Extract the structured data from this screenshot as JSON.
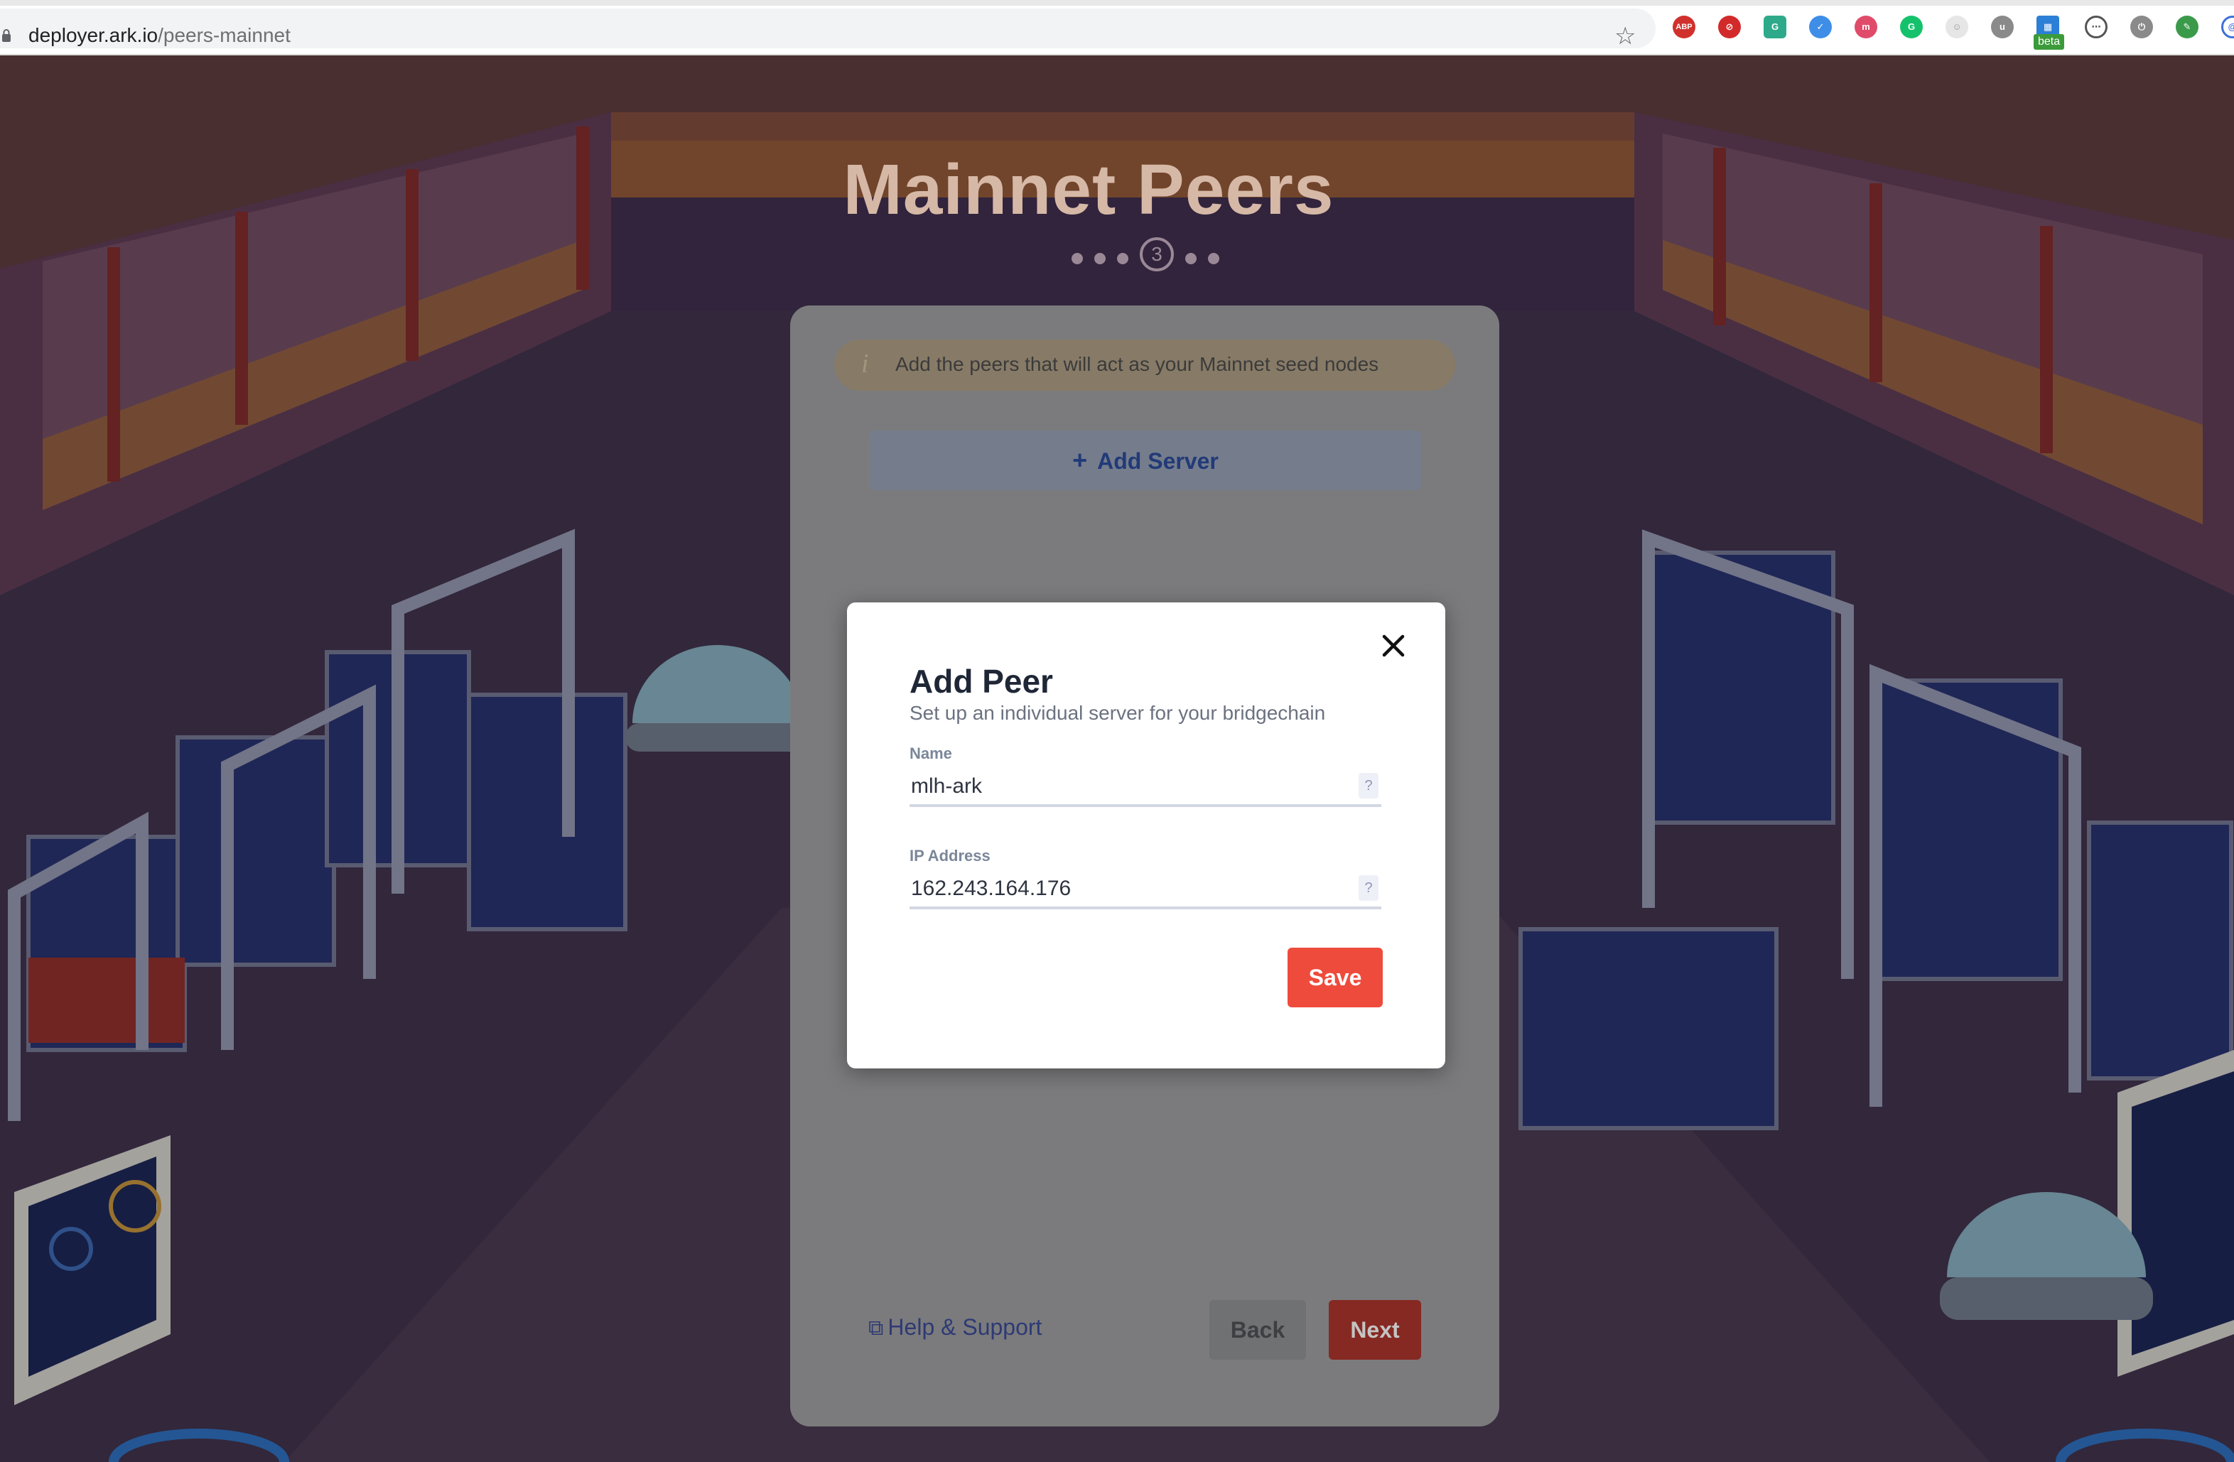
{
  "browser": {
    "url_host": "deployer.ark.io",
    "url_path": "/peers-mainnet",
    "extension_badge": "beta"
  },
  "page": {
    "title": "Mainnet Peers",
    "current_step": "3",
    "info_text": "Add the peers that will act as your Mainnet seed nodes",
    "add_server_label": "Add Server",
    "help_link": "Help & Support",
    "back_label": "Back",
    "next_label": "Next"
  },
  "modal": {
    "title": "Add Peer",
    "subtitle": "Set up an individual server for your bridgechain",
    "name_label": "Name",
    "name_value": "mlh-ark",
    "ip_label": "IP Address",
    "ip_value": "162.243.164.176",
    "help_glyph": "?",
    "save_label": "Save"
  },
  "colors": {
    "accent_red": "#ee4b3c",
    "text_dark": "#1f2737",
    "link_blue": "#2d3a74"
  },
  "icons": [
    "lock-icon",
    "star-icon",
    "close-icon",
    "info-icon",
    "plus-icon",
    "external-link-icon"
  ]
}
